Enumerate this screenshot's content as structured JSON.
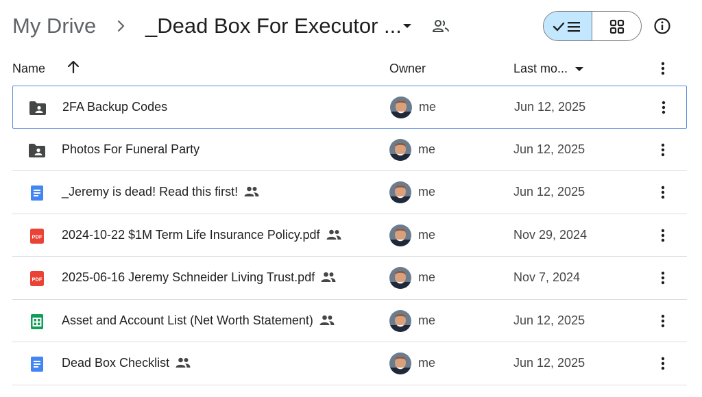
{
  "breadcrumb": {
    "root": "My Drive",
    "current": "_Dead Box For Executor ..."
  },
  "view": {
    "active": "list"
  },
  "columns": {
    "name": "Name",
    "owner": "Owner",
    "modified": "Last mo..."
  },
  "files": [
    {
      "name": "2FA Backup Codes",
      "type": "shared-folder-icon",
      "shared": false,
      "owner": "me",
      "modified": "Jun 12, 2025",
      "selected": true
    },
    {
      "name": "Photos For Funeral Party",
      "type": "shared-folder-icon",
      "shared": false,
      "owner": "me",
      "modified": "Jun 12, 2025",
      "selected": false
    },
    {
      "name": "_Jeremy is dead! Read this first!",
      "type": "google-doc-icon",
      "shared": true,
      "owner": "me",
      "modified": "Jun 12, 2025",
      "selected": false
    },
    {
      "name": "2024-10-22 $1M Term Life Insurance Policy.pdf",
      "type": "pdf-icon",
      "shared": true,
      "owner": "me",
      "modified": "Nov 29, 2024",
      "selected": false
    },
    {
      "name": "2025-06-16 Jeremy Schneider Living Trust.pdf",
      "type": "pdf-icon",
      "shared": true,
      "owner": "me",
      "modified": "Nov 7, 2024",
      "selected": false
    },
    {
      "name": "Asset and Account List (Net Worth Statement)",
      "type": "google-sheet-icon",
      "shared": true,
      "owner": "me",
      "modified": "Jun 12, 2025",
      "selected": false
    },
    {
      "name": "Dead Box Checklist",
      "type": "google-doc-icon",
      "shared": true,
      "owner": "me",
      "modified": "Jun 12, 2025",
      "selected": false
    }
  ],
  "pdf_badge": "PDF",
  "colors": {
    "accent": "#c2e7ff",
    "selection_border": "#5b8bd8",
    "doc_blue": "#4285f4",
    "pdf_red": "#ea4335",
    "sheet_green": "#0f9d58",
    "folder_grey": "#444746"
  }
}
